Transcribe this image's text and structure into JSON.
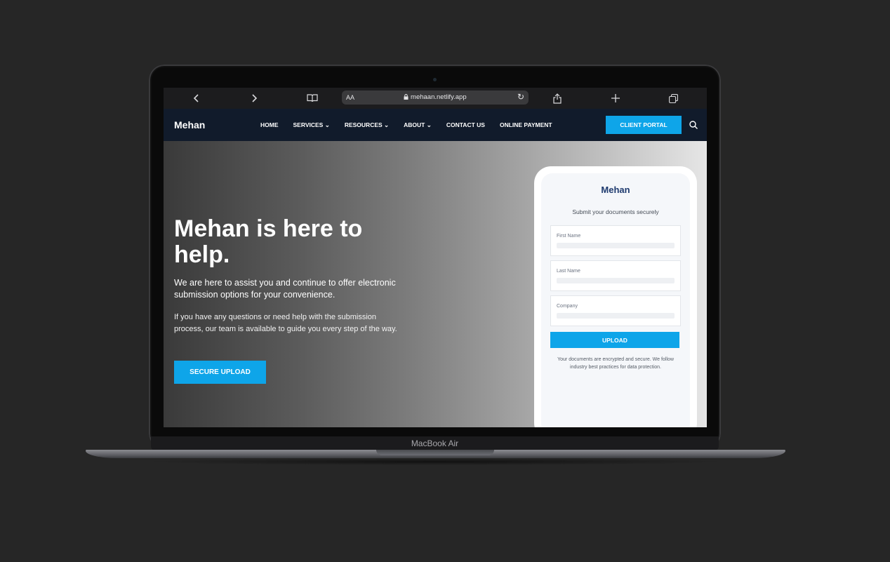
{
  "device": {
    "model_label": "MacBook Air"
  },
  "browser": {
    "reader_aa": "AA",
    "url": "mehaan.netlify.app",
    "icons": [
      "chevron-left-icon",
      "chevron-right-icon",
      "book-icon",
      "lock-icon",
      "reload-icon",
      "share-icon",
      "plus-icon",
      "tabs-icon"
    ]
  },
  "site": {
    "logo": "Mehan",
    "nav": [
      {
        "label": "HOME"
      },
      {
        "label": "SERVICES ⌄"
      },
      {
        "label": "RESOURCES ⌄"
      },
      {
        "label": "ABOUT ⌄"
      },
      {
        "label": "CONTACT US"
      },
      {
        "label": "ONLINE PAYMENT"
      }
    ],
    "portal_button": "CLIENT PORTAL",
    "accent_color": "#0ea5e9",
    "nav_bg": "#111b2b"
  },
  "hero": {
    "title": "Mehan is here to help.",
    "paragraph1": "We are here to assist you and continue to offer electronic submission options for your convenience.",
    "paragraph2": "If you have any questions or need help with the submission process, our team is available to guide you every step of the way.",
    "button": "SECURE UPLOAD"
  },
  "upload_form": {
    "logo": "Mehan",
    "subtitle": "Submit your documents securely",
    "fields": [
      {
        "label": "First Name"
      },
      {
        "label": "Last Name"
      },
      {
        "label": "Company"
      }
    ],
    "button": "UPLOAD",
    "note": "Your documents are encrypted and secure. We follow industry best practices for data protection."
  }
}
